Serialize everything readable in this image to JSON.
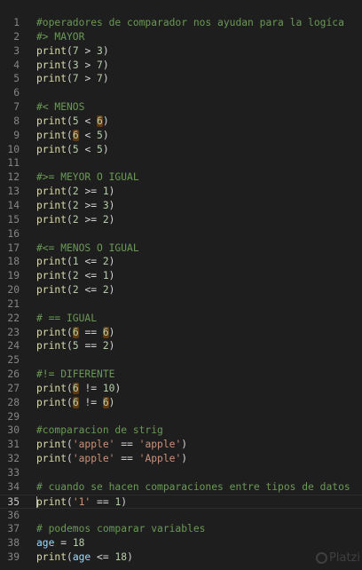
{
  "editor": {
    "active_line": 35,
    "lines": [
      {
        "n": "1",
        "tokens": [
          {
            "t": "#operadores de comparador nos ayudan para la logíca",
            "c": "comment"
          }
        ]
      },
      {
        "n": "2",
        "tokens": [
          {
            "t": "#> MAYOR",
            "c": "comment"
          }
        ]
      },
      {
        "n": "3",
        "tokens": [
          {
            "t": "print",
            "c": "fn"
          },
          {
            "t": "(",
            "c": "op"
          },
          {
            "t": "7",
            "c": "num"
          },
          {
            "t": " > ",
            "c": "op"
          },
          {
            "t": "3",
            "c": "num"
          },
          {
            "t": ")",
            "c": "op"
          }
        ]
      },
      {
        "n": "4",
        "tokens": [
          {
            "t": "print",
            "c": "fn"
          },
          {
            "t": "(",
            "c": "op"
          },
          {
            "t": "3",
            "c": "num"
          },
          {
            "t": " > ",
            "c": "op"
          },
          {
            "t": "7",
            "c": "num"
          },
          {
            "t": ")",
            "c": "op"
          }
        ]
      },
      {
        "n": "5",
        "tokens": [
          {
            "t": "print",
            "c": "fn"
          },
          {
            "t": "(",
            "c": "op"
          },
          {
            "t": "7",
            "c": "num"
          },
          {
            "t": " > ",
            "c": "op"
          },
          {
            "t": "7",
            "c": "num"
          },
          {
            "t": ")",
            "c": "op"
          }
        ]
      },
      {
        "n": "6",
        "tokens": []
      },
      {
        "n": "7",
        "tokens": [
          {
            "t": "#< MENOS",
            "c": "comment"
          }
        ]
      },
      {
        "n": "8",
        "tokens": [
          {
            "t": "print",
            "c": "fn"
          },
          {
            "t": "(",
            "c": "op"
          },
          {
            "t": "5",
            "c": "num"
          },
          {
            "t": " < ",
            "c": "op"
          },
          {
            "t": "6",
            "c": "hl"
          },
          {
            "t": ")",
            "c": "op"
          }
        ]
      },
      {
        "n": "9",
        "tokens": [
          {
            "t": "print",
            "c": "fn"
          },
          {
            "t": "(",
            "c": "op"
          },
          {
            "t": "6",
            "c": "hl"
          },
          {
            "t": " < ",
            "c": "op"
          },
          {
            "t": "5",
            "c": "num"
          },
          {
            "t": ")",
            "c": "op"
          }
        ]
      },
      {
        "n": "10",
        "tokens": [
          {
            "t": "print",
            "c": "fn"
          },
          {
            "t": "(",
            "c": "op"
          },
          {
            "t": "5",
            "c": "num"
          },
          {
            "t": " < ",
            "c": "op"
          },
          {
            "t": "5",
            "c": "num"
          },
          {
            "t": ")",
            "c": "op"
          }
        ]
      },
      {
        "n": "11",
        "tokens": []
      },
      {
        "n": "12",
        "tokens": [
          {
            "t": "#>= MEYOR O IGUAL",
            "c": "comment"
          }
        ]
      },
      {
        "n": "13",
        "tokens": [
          {
            "t": "print",
            "c": "fn"
          },
          {
            "t": "(",
            "c": "op"
          },
          {
            "t": "2",
            "c": "num"
          },
          {
            "t": " >= ",
            "c": "op"
          },
          {
            "t": "1",
            "c": "num"
          },
          {
            "t": ")",
            "c": "op"
          }
        ]
      },
      {
        "n": "14",
        "tokens": [
          {
            "t": "print",
            "c": "fn"
          },
          {
            "t": "(",
            "c": "op"
          },
          {
            "t": "2",
            "c": "num"
          },
          {
            "t": " >= ",
            "c": "op"
          },
          {
            "t": "3",
            "c": "num"
          },
          {
            "t": ")",
            "c": "op"
          }
        ]
      },
      {
        "n": "15",
        "tokens": [
          {
            "t": "print",
            "c": "fn"
          },
          {
            "t": "(",
            "c": "op"
          },
          {
            "t": "2",
            "c": "num"
          },
          {
            "t": " >= ",
            "c": "op"
          },
          {
            "t": "2",
            "c": "num"
          },
          {
            "t": ")",
            "c": "op"
          }
        ]
      },
      {
        "n": "16",
        "tokens": []
      },
      {
        "n": "17",
        "tokens": [
          {
            "t": "#<= MENOS O IGUAL",
            "c": "comment"
          }
        ]
      },
      {
        "n": "18",
        "tokens": [
          {
            "t": "print",
            "c": "fn"
          },
          {
            "t": "(",
            "c": "op"
          },
          {
            "t": "1",
            "c": "num"
          },
          {
            "t": " <= ",
            "c": "op"
          },
          {
            "t": "2",
            "c": "num"
          },
          {
            "t": ")",
            "c": "op"
          }
        ]
      },
      {
        "n": "19",
        "tokens": [
          {
            "t": "print",
            "c": "fn"
          },
          {
            "t": "(",
            "c": "op"
          },
          {
            "t": "2",
            "c": "num"
          },
          {
            "t": " <= ",
            "c": "op"
          },
          {
            "t": "1",
            "c": "num"
          },
          {
            "t": ")",
            "c": "op"
          }
        ]
      },
      {
        "n": "20",
        "tokens": [
          {
            "t": "print",
            "c": "fn"
          },
          {
            "t": "(",
            "c": "op"
          },
          {
            "t": "2",
            "c": "num"
          },
          {
            "t": " <= ",
            "c": "op"
          },
          {
            "t": "2",
            "c": "num"
          },
          {
            "t": ")",
            "c": "op"
          }
        ]
      },
      {
        "n": "21",
        "tokens": []
      },
      {
        "n": "22",
        "tokens": [
          {
            "t": "# == IGUAL",
            "c": "comment"
          }
        ]
      },
      {
        "n": "23",
        "tokens": [
          {
            "t": "print",
            "c": "fn"
          },
          {
            "t": "(",
            "c": "op"
          },
          {
            "t": "6",
            "c": "hl"
          },
          {
            "t": " == ",
            "c": "op"
          },
          {
            "t": "6",
            "c": "hl"
          },
          {
            "t": ")",
            "c": "op"
          }
        ]
      },
      {
        "n": "24",
        "tokens": [
          {
            "t": "print",
            "c": "fn"
          },
          {
            "t": "(",
            "c": "op"
          },
          {
            "t": "5",
            "c": "num"
          },
          {
            "t": " == ",
            "c": "op"
          },
          {
            "t": "2",
            "c": "num"
          },
          {
            "t": ")",
            "c": "op"
          }
        ]
      },
      {
        "n": "25",
        "tokens": []
      },
      {
        "n": "26",
        "tokens": [
          {
            "t": "#!= DIFERENTE",
            "c": "comment"
          }
        ]
      },
      {
        "n": "27",
        "tokens": [
          {
            "t": "print",
            "c": "fn"
          },
          {
            "t": "(",
            "c": "op"
          },
          {
            "t": "6",
            "c": "hl"
          },
          {
            "t": " != ",
            "c": "op"
          },
          {
            "t": "10",
            "c": "num"
          },
          {
            "t": ")",
            "c": "op"
          }
        ]
      },
      {
        "n": "28",
        "tokens": [
          {
            "t": "print",
            "c": "fn"
          },
          {
            "t": "(",
            "c": "op"
          },
          {
            "t": "6",
            "c": "hl"
          },
          {
            "t": " != ",
            "c": "op"
          },
          {
            "t": "6",
            "c": "hl"
          },
          {
            "t": ")",
            "c": "op"
          }
        ]
      },
      {
        "n": "29",
        "tokens": []
      },
      {
        "n": "30",
        "tokens": [
          {
            "t": "#comparacion de strig",
            "c": "comment"
          }
        ]
      },
      {
        "n": "31",
        "tokens": [
          {
            "t": "print",
            "c": "fn"
          },
          {
            "t": "(",
            "c": "op"
          },
          {
            "t": "'apple'",
            "c": "str"
          },
          {
            "t": " == ",
            "c": "op"
          },
          {
            "t": "'apple'",
            "c": "str"
          },
          {
            "t": ")",
            "c": "op"
          }
        ]
      },
      {
        "n": "32",
        "tokens": [
          {
            "t": "print",
            "c": "fn"
          },
          {
            "t": "(",
            "c": "op"
          },
          {
            "t": "'apple'",
            "c": "str"
          },
          {
            "t": " == ",
            "c": "op"
          },
          {
            "t": "'Apple'",
            "c": "str"
          },
          {
            "t": ")",
            "c": "op"
          }
        ]
      },
      {
        "n": "33",
        "tokens": []
      },
      {
        "n": "34",
        "tokens": [
          {
            "t": "# cuando se hacen comparaciones entre tipos de datos",
            "c": "comment"
          }
        ]
      },
      {
        "n": "35",
        "tokens": [
          {
            "t": "print",
            "c": "fn"
          },
          {
            "t": "(",
            "c": "op"
          },
          {
            "t": "'1'",
            "c": "str"
          },
          {
            "t": " == ",
            "c": "op"
          },
          {
            "t": "1",
            "c": "num"
          },
          {
            "t": ")",
            "c": "op"
          }
        ]
      },
      {
        "n": "36",
        "tokens": []
      },
      {
        "n": "37",
        "tokens": [
          {
            "t": "# podemos comparar variables",
            "c": "comment"
          }
        ]
      },
      {
        "n": "38",
        "tokens": [
          {
            "t": "age",
            "c": "var"
          },
          {
            "t": " = ",
            "c": "op"
          },
          {
            "t": "18",
            "c": "num"
          }
        ]
      },
      {
        "n": "39",
        "tokens": [
          {
            "t": "print",
            "c": "fn"
          },
          {
            "t": "(",
            "c": "op"
          },
          {
            "t": "age",
            "c": "var"
          },
          {
            "t": " <= ",
            "c": "op"
          },
          {
            "t": "18",
            "c": "num"
          },
          {
            "t": ")",
            "c": "op"
          }
        ]
      }
    ]
  },
  "watermark": {
    "text": "Platzi",
    "icon": "platzi-logo-icon"
  },
  "colors": {
    "background": "#1e1e1e",
    "line_number": "#858585",
    "comment": "#6a9955",
    "function": "#dcdcaa",
    "number": "#b5cea8",
    "string": "#ce9178",
    "variable": "#9cdcfe",
    "highlight_bg": "#613a0f"
  }
}
